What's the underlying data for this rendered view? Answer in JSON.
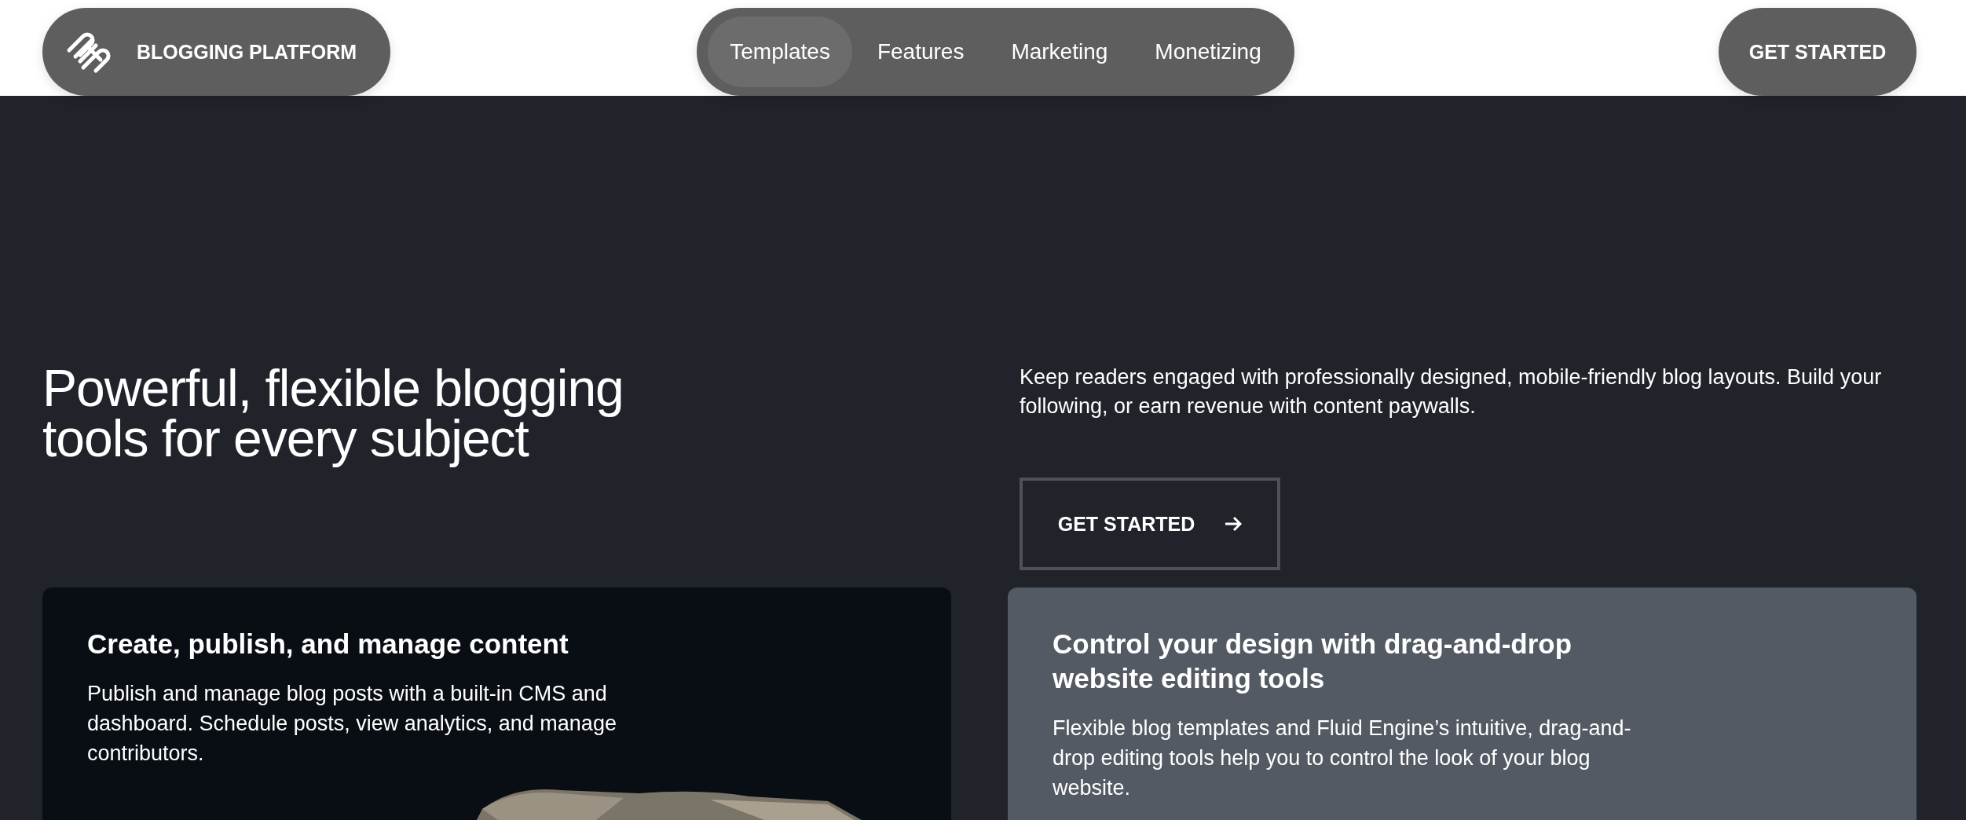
{
  "header": {
    "brand": "BLOGGING PLATFORM",
    "nav": [
      {
        "label": "Templates",
        "selected": true
      },
      {
        "label": "Features",
        "selected": false
      },
      {
        "label": "Marketing",
        "selected": false
      },
      {
        "label": "Monetizing",
        "selected": false
      }
    ],
    "cta": "GET STARTED"
  },
  "hero": {
    "title": "Powerful, flexible blogging tools for every subject",
    "description": "Keep readers engaged with professionally designed, mobile-friendly blog layouts. Build your following, or earn revenue with content paywalls.",
    "button": "GET STARTED"
  },
  "cards": [
    {
      "kind": "picture",
      "title": "Create, publish, and manage content",
      "text": "Publish and manage blog posts with a built-in CMS and dashboard. Schedule posts, view analytics, and manage contributors."
    },
    {
      "kind": "plain",
      "title": "Control your design with drag-and-drop website editing tools",
      "text": "Flexible blog templates and Fluid Engine’s intuitive, drag-and-drop editing tools help you to control the look of your blog website."
    }
  ]
}
